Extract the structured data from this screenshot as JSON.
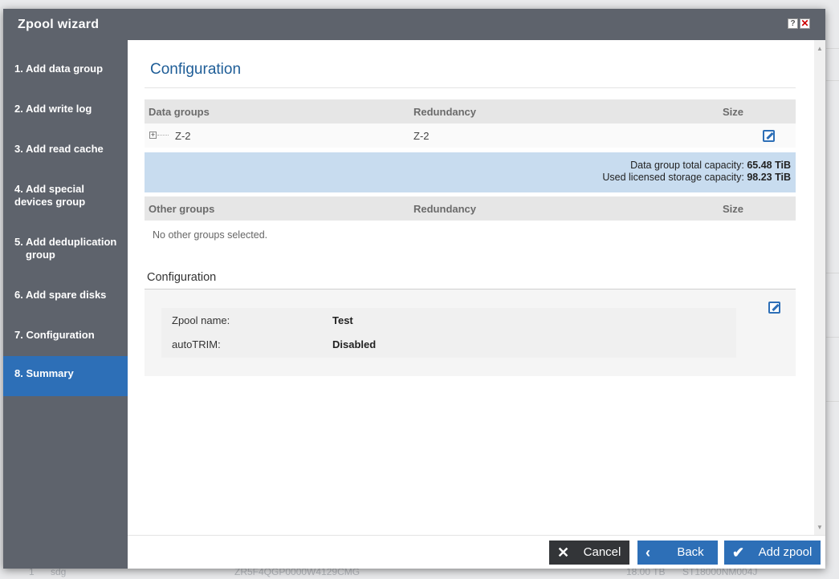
{
  "dialog": {
    "title": "Zpool wizard",
    "help_label": "?",
    "close_label": "✕"
  },
  "steps": [
    {
      "label": "1. Add data group"
    },
    {
      "label": "2. Add write log"
    },
    {
      "label": "3. Add read cache"
    },
    {
      "label": "4. Add special devices group"
    },
    {
      "label_line1": "5. Add deduplication",
      "label_line2": "group"
    },
    {
      "label": "6. Add spare disks"
    },
    {
      "label": "7. Configuration"
    },
    {
      "label": "8. Summary"
    }
  ],
  "active_step": 8,
  "page_title": "Configuration",
  "data_groups_table": {
    "headers": [
      "Data groups",
      "Redundancy",
      "Size"
    ],
    "rows": [
      {
        "expander": "+",
        "name": "Z-2",
        "redundancy": "Z-2",
        "size": ""
      }
    ]
  },
  "capacity": {
    "total_label": "Data group total capacity:",
    "total_value": "65.48 TiB",
    "licensed_label": "Used licensed storage capacity:",
    "licensed_value": "98.23 TiB"
  },
  "other_groups_table": {
    "headers": [
      "Other groups",
      "Redundancy",
      "Size"
    ],
    "empty_text": "No other groups selected."
  },
  "configuration": {
    "section_title": "Configuration",
    "fields": [
      {
        "label": "Zpool name:",
        "value": "Test"
      },
      {
        "label": "autoTRIM:",
        "value": "Disabled"
      }
    ]
  },
  "buttons": {
    "cancel": "Cancel",
    "back": "Back",
    "add": "Add zpool"
  },
  "background": {
    "row_index": "1",
    "row_device": "sdg",
    "row_serial": "ZR5F4QGP0000W4129CMG",
    "row_size": "18.00 TB",
    "row_model": "ST18000NM004J"
  },
  "colors": {
    "accent": "#2d6fb7",
    "sidebar": "#5e636c",
    "capacity_bg": "#c8dcef",
    "cancel_bg": "#333538"
  }
}
